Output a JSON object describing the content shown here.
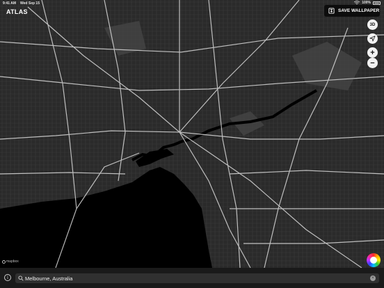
{
  "status_bar": {
    "time": "9:41 AM",
    "date": "Wed Sep 15",
    "battery": "100%"
  },
  "app": {
    "title": "ATLAS"
  },
  "toolbar": {
    "save_wallpaper_label": "SAVE WALLPAPER"
  },
  "map_controls": {
    "three_d_label": "3D",
    "zoom_in_label": "+",
    "zoom_out_label": "−"
  },
  "attribution": {
    "label": "mapbox"
  },
  "search": {
    "value": "Melbourne, Australia",
    "info_label": "i",
    "clear_label": "×"
  },
  "colors": {
    "land": "#2a2a2a",
    "water": "#000000",
    "roads": "#d9d9d9",
    "park": "#4a4a4a",
    "ui_bar": "#1a1a1a"
  }
}
